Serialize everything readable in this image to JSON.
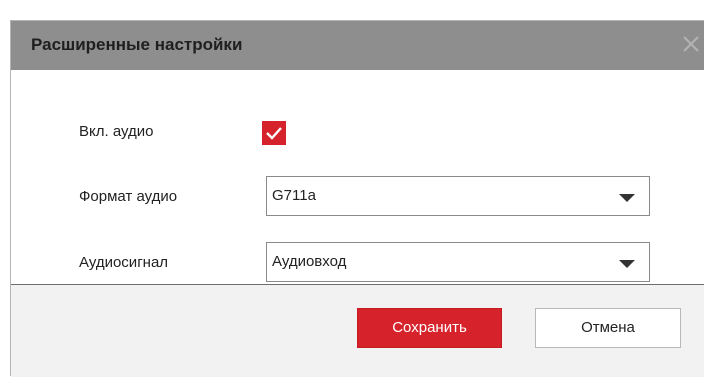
{
  "dialog": {
    "title": "Расширенные настройки",
    "close_icon": "close-icon"
  },
  "fields": {
    "audio_enabled": {
      "label": "Вкл. аудио",
      "checked": true
    },
    "audio_format": {
      "label": "Формат аудио",
      "value": "G711a"
    },
    "audio_signal": {
      "label": "Аудиосигнал",
      "value": "Аудиовход"
    }
  },
  "footer": {
    "save_label": "Сохранить",
    "cancel_label": "Отмена"
  },
  "colors": {
    "header_bg": "#8e8e8e",
    "accent": "#d6232b",
    "footer_bg": "#f2f2f2"
  }
}
